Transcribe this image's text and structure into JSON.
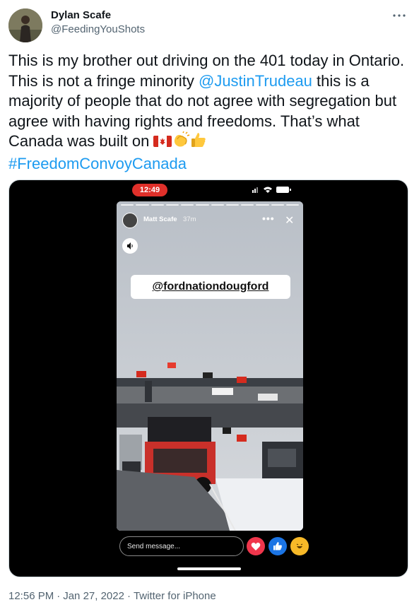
{
  "author": {
    "display_name": "Dylan Scafe",
    "handle": "@FeedingYouShots"
  },
  "menu": {
    "icon": "more-horizontal-icon"
  },
  "tweet": {
    "text_part1": "This is my brother out driving on the 401 today in Ontario. This is not a fringe minority ",
    "mention": "@JustinTrudeau",
    "text_part2": " this is a majority of people that do not agree with segregation but agree with having rights and freedoms. That’s what Canada was built on ",
    "emojis": [
      "canada-flag-icon",
      "clapping-hands-icon",
      "thumbs-up-icon"
    ],
    "hashtag": "#FreedomConvoyCanada"
  },
  "media": {
    "phone_time": "12:49",
    "story_user": "Matt Scafe",
    "story_time": "37m",
    "sticker_text": "@fordnationdougford",
    "send_placeholder": "Send message...",
    "reactions": [
      "heart-reaction-icon",
      "like-reaction-icon",
      "haha-reaction-icon"
    ]
  },
  "meta": {
    "time": "12:56 PM",
    "date": "Jan 27, 2022",
    "separator": "·",
    "source": "Twitter for iPhone"
  },
  "colors": {
    "link": "#1d9bf0",
    "text": "#0f1419",
    "secondary": "#536471",
    "recording_badge": "#e0302a"
  }
}
